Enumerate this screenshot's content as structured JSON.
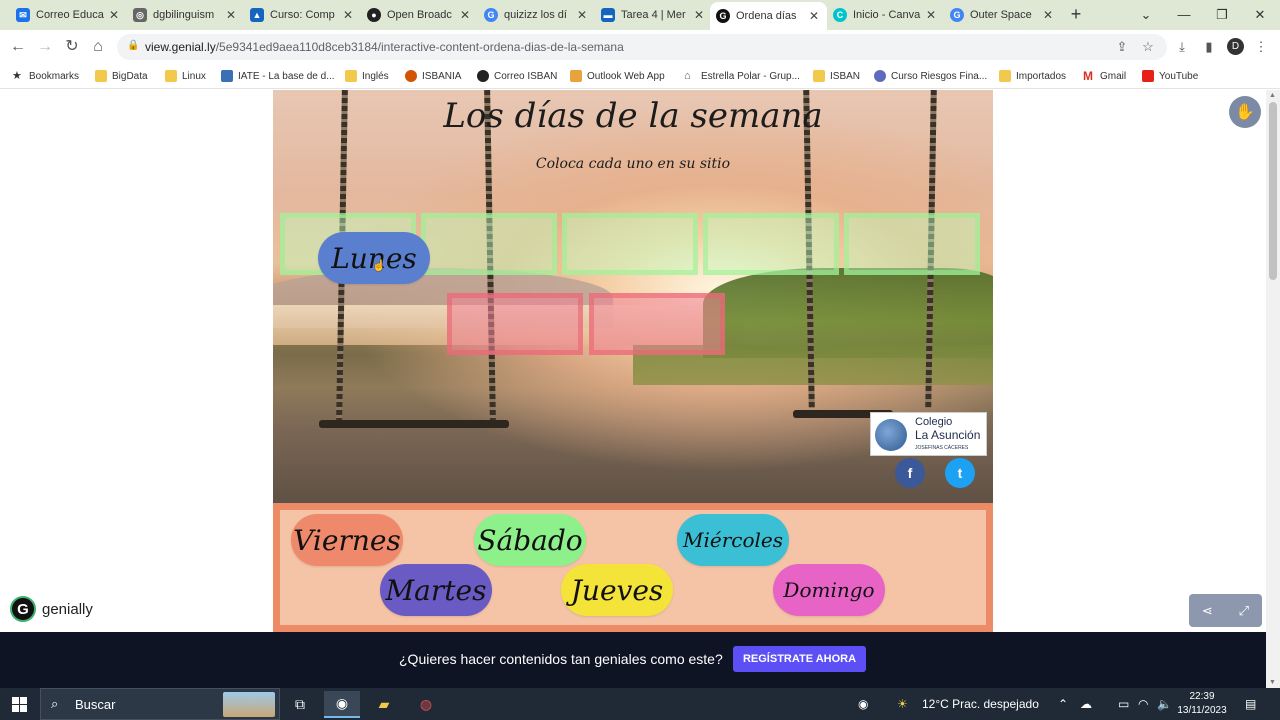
{
  "browser": {
    "tabs": [
      {
        "title": "Correo Educa",
        "icon": "mail-icon",
        "color": "#1a73e8"
      },
      {
        "title": "dgbilinguism",
        "icon": "web-icon",
        "color": "#555555"
      },
      {
        "title": "Curso: Comp",
        "icon": "course-icon",
        "color": "#1565c0"
      },
      {
        "title": "Open Broadc",
        "icon": "obs-icon",
        "color": "#222222"
      },
      {
        "title": "quizizz los dí",
        "icon": "google-icon",
        "color": "#4285f4"
      },
      {
        "title": "Tarea 4 | Mer",
        "icon": "board-icon",
        "color": "#1565c0"
      },
      {
        "title": "Ordena días",
        "icon": "genially-icon",
        "color": "#111111",
        "active": true
      },
      {
        "title": "Inicio - Canva",
        "icon": "canva-icon",
        "color": "#00c4cc"
      },
      {
        "title": "Outer Space",
        "icon": "google-icon",
        "color": "#4285f4"
      }
    ],
    "url_host": "view.genial.ly",
    "url_path": "/5e9341ed9aea110d8ceb3184/interactive-content-ordena-dias-de-la-semana",
    "profile_initial": "D",
    "bookmarks": [
      {
        "label": "Bookmarks",
        "icon": "star-icon"
      },
      {
        "label": "BigData",
        "icon": "folder-icon"
      },
      {
        "label": "Linux",
        "icon": "folder-icon"
      },
      {
        "label": "IATE - La base de d...",
        "icon": "iate-icon"
      },
      {
        "label": "Inglés",
        "icon": "folder-icon"
      },
      {
        "label": "ISBANIA",
        "icon": "isbania-icon"
      },
      {
        "label": "Correo ISBAN",
        "icon": "mail-icon"
      },
      {
        "label": "Outlook Web App",
        "icon": "outlook-icon"
      },
      {
        "label": "Estrella Polar - Grup...",
        "icon": "home-icon"
      },
      {
        "label": "ISBAN",
        "icon": "folder-icon"
      },
      {
        "label": "Curso Riesgos Fina...",
        "icon": "course-icon"
      },
      {
        "label": "Importados",
        "icon": "folder-icon"
      },
      {
        "label": "Gmail",
        "icon": "gmail-icon"
      },
      {
        "label": "YouTube",
        "icon": "youtube-icon"
      }
    ]
  },
  "activity": {
    "title": "Los días de la semana",
    "subtitle": "Coloca cada uno en su sitio",
    "placed_day": {
      "label": "Lunes",
      "color": "#5b7fcf"
    },
    "tray_days": [
      {
        "label": "Viernes",
        "color": "#ee8a6b"
      },
      {
        "label": "Sábado",
        "color": "#8df08a"
      },
      {
        "label": "Miércoles",
        "color": "#3bbfd4"
      },
      {
        "label": "Martes",
        "color": "#6a5ac4"
      },
      {
        "label": "Jueves",
        "color": "#f4e338"
      },
      {
        "label": "Domingo",
        "color": "#e863c6"
      }
    ],
    "school_logo": {
      "line1": "Colegio",
      "line2": "La Asunción",
      "line3": "JOSEFINAS CÁCERES"
    }
  },
  "genially": {
    "brand": "genially"
  },
  "banner": {
    "question": "¿Quieres hacer contenidos tan geniales como este?",
    "cta": "REGÍSTRATE AHORA"
  },
  "taskbar": {
    "search_placeholder": "Buscar",
    "weather": "12°C  Prac. despejado",
    "time": "22:39",
    "date": "13/11/2023"
  }
}
